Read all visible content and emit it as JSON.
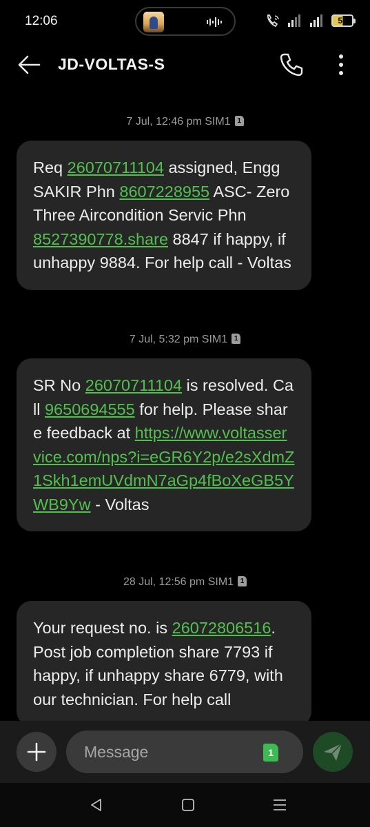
{
  "status_bar": {
    "time": "12:06",
    "battery": "51"
  },
  "header": {
    "title": "JD-VOLTAS-S"
  },
  "messages": [
    {
      "timestamp": "7 Jul, 12:46 pm",
      "sim": "SIM1",
      "parts": [
        {
          "t": "Req "
        },
        {
          "t": "26070711104",
          "link": true
        },
        {
          "t": " assigned, Engg SAKIR Phn "
        },
        {
          "t": "8607228955",
          "link": true
        },
        {
          "t": " ASC- Zero Three Aircondition Servic Phn "
        },
        {
          "t": "8527390778.share",
          "link": true
        },
        {
          "t": " 8847 if happy, if unhappy 9884. For help call - Voltas"
        }
      ]
    },
    {
      "timestamp": "7 Jul, 5:32 pm",
      "sim": "SIM1",
      "parts": [
        {
          "t": "SR No "
        },
        {
          "t": "26070711104",
          "link": true
        },
        {
          "t": " is resolved. Call "
        },
        {
          "t": "9650694555",
          "link": true
        },
        {
          "t": " for help. Please share feedback at "
        },
        {
          "t": "https://www.voltasservice.com/nps?i=eGR6Y2p/e2sXdmZ1Skh1emUVdmN7aGp4fBoXeGB5YWB9Yw",
          "link": true
        },
        {
          "t": " - Voltas"
        }
      ]
    },
    {
      "timestamp": "28 Jul, 12:56 pm",
      "sim": "SIM1",
      "parts": [
        {
          "t": "Your request no. is "
        },
        {
          "t": "26072806516",
          "link": true
        },
        {
          "t": ". Post job completion share 7793 if happy, if unhappy share 6779, with our technician. For help call"
        }
      ]
    }
  ],
  "composer": {
    "placeholder": "Message",
    "sim_badge": "1"
  },
  "colors": {
    "link": "#52c04f",
    "bubble": "#262626",
    "background": "#000000"
  }
}
